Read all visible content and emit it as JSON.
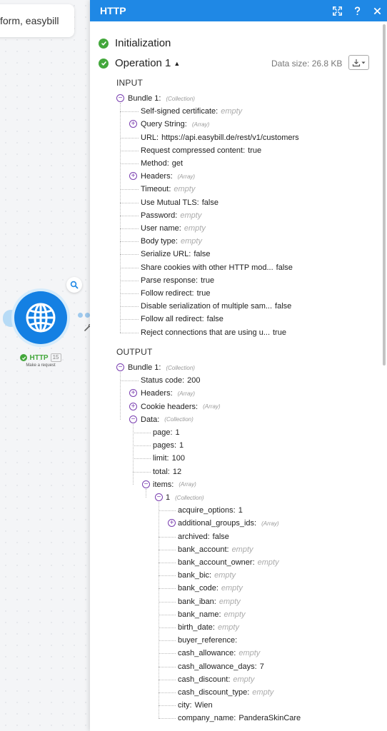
{
  "canvas": {
    "search_card_text": "form, easybill",
    "module": {
      "name": "HTTP",
      "badge": "15",
      "subtitle": "Make a request"
    }
  },
  "panel": {
    "title": "HTTP",
    "initialization_label": "Initialization",
    "operation_label": "Operation 1",
    "data_size": "Data size: 26.8 KB",
    "input_label": "INPUT",
    "output_label": "OUTPUT"
  },
  "colors": {
    "header": "#1f88e5",
    "success": "#43a73b",
    "toggle": "#7a3fb0",
    "module": "#1480e3"
  },
  "input_tree": [
    {
      "key": "Bundle 1:",
      "type": "(Collection)",
      "toggle": "minus",
      "depth": 0
    },
    {
      "key": "Self-signed certificate:",
      "value": "empty",
      "empty": true,
      "depth": 1
    },
    {
      "key": "Query String:",
      "type": "(Array)",
      "toggle": "plus",
      "depth": 1
    },
    {
      "key": "URL:",
      "value": "https://api.easybill.de/rest/v1/customers",
      "depth": 1
    },
    {
      "key": "Request compressed content:",
      "value": "true",
      "depth": 1
    },
    {
      "key": "Method:",
      "value": "get",
      "depth": 1
    },
    {
      "key": "Headers:",
      "type": "(Array)",
      "toggle": "plus",
      "depth": 1
    },
    {
      "key": "Timeout:",
      "value": "empty",
      "empty": true,
      "depth": 1
    },
    {
      "key": "Use Mutual TLS:",
      "value": "false",
      "depth": 1
    },
    {
      "key": "Password:",
      "value": "empty",
      "empty": true,
      "depth": 1
    },
    {
      "key": "User name:",
      "value": "empty",
      "empty": true,
      "depth": 1
    },
    {
      "key": "Body type:",
      "value": "empty",
      "empty": true,
      "depth": 1
    },
    {
      "key": "Serialize URL:",
      "value": "false",
      "depth": 1
    },
    {
      "key": "Share cookies with other HTTP mod...",
      "value": "false",
      "depth": 1
    },
    {
      "key": "Parse response:",
      "value": "true",
      "depth": 1
    },
    {
      "key": "Follow redirect:",
      "value": "true",
      "depth": 1
    },
    {
      "key": "Disable serialization of multiple sam...",
      "value": "false",
      "depth": 1
    },
    {
      "key": "Follow all redirect:",
      "value": "false",
      "depth": 1
    },
    {
      "key": "Reject connections that are using u...",
      "value": "true",
      "depth": 1
    }
  ],
  "output_tree": [
    {
      "key": "Bundle 1:",
      "type": "(Collection)",
      "toggle": "minus",
      "depth": 0
    },
    {
      "key": "Status code:",
      "value": "200",
      "depth": 1
    },
    {
      "key": "Headers:",
      "type": "(Array)",
      "toggle": "plus",
      "depth": 1
    },
    {
      "key": "Cookie headers:",
      "type": "(Array)",
      "toggle": "plus",
      "depth": 1
    },
    {
      "key": "Data:",
      "type": "(Collection)",
      "toggle": "minus",
      "depth": 1
    },
    {
      "key": "page:",
      "value": "1",
      "depth": 2
    },
    {
      "key": "pages:",
      "value": "1",
      "depth": 2
    },
    {
      "key": "limit:",
      "value": "100",
      "depth": 2
    },
    {
      "key": "total:",
      "value": "12",
      "depth": 2
    },
    {
      "key": "items:",
      "type": "(Array)",
      "toggle": "minus",
      "depth": 2
    },
    {
      "key": "1",
      "type": "(Collection)",
      "toggle": "minus",
      "depth": 3
    },
    {
      "key": "acquire_options:",
      "value": "1",
      "depth": 4
    },
    {
      "key": "additional_groups_ids:",
      "type": "(Array)",
      "toggle": "plus",
      "depth": 4
    },
    {
      "key": "archived:",
      "value": "false",
      "depth": 4
    },
    {
      "key": "bank_account:",
      "value": "empty",
      "empty": true,
      "depth": 4
    },
    {
      "key": "bank_account_owner:",
      "value": "empty",
      "empty": true,
      "depth": 4
    },
    {
      "key": "bank_bic:",
      "value": "empty",
      "empty": true,
      "depth": 4
    },
    {
      "key": "bank_code:",
      "value": "empty",
      "empty": true,
      "depth": 4
    },
    {
      "key": "bank_iban:",
      "value": "empty",
      "empty": true,
      "depth": 4
    },
    {
      "key": "bank_name:",
      "value": "empty",
      "empty": true,
      "depth": 4
    },
    {
      "key": "birth_date:",
      "value": "empty",
      "empty": true,
      "depth": 4
    },
    {
      "key": "buyer_reference:",
      "value": "",
      "depth": 4
    },
    {
      "key": "cash_allowance:",
      "value": "empty",
      "empty": true,
      "depth": 4
    },
    {
      "key": "cash_allowance_days:",
      "value": "7",
      "depth": 4
    },
    {
      "key": "cash_discount:",
      "value": "empty",
      "empty": true,
      "depth": 4
    },
    {
      "key": "cash_discount_type:",
      "value": "empty",
      "empty": true,
      "depth": 4
    },
    {
      "key": "city:",
      "value": "Wien",
      "depth": 4
    },
    {
      "key": "company_name:",
      "value": "PanderaSkinCare",
      "depth": 4
    }
  ]
}
